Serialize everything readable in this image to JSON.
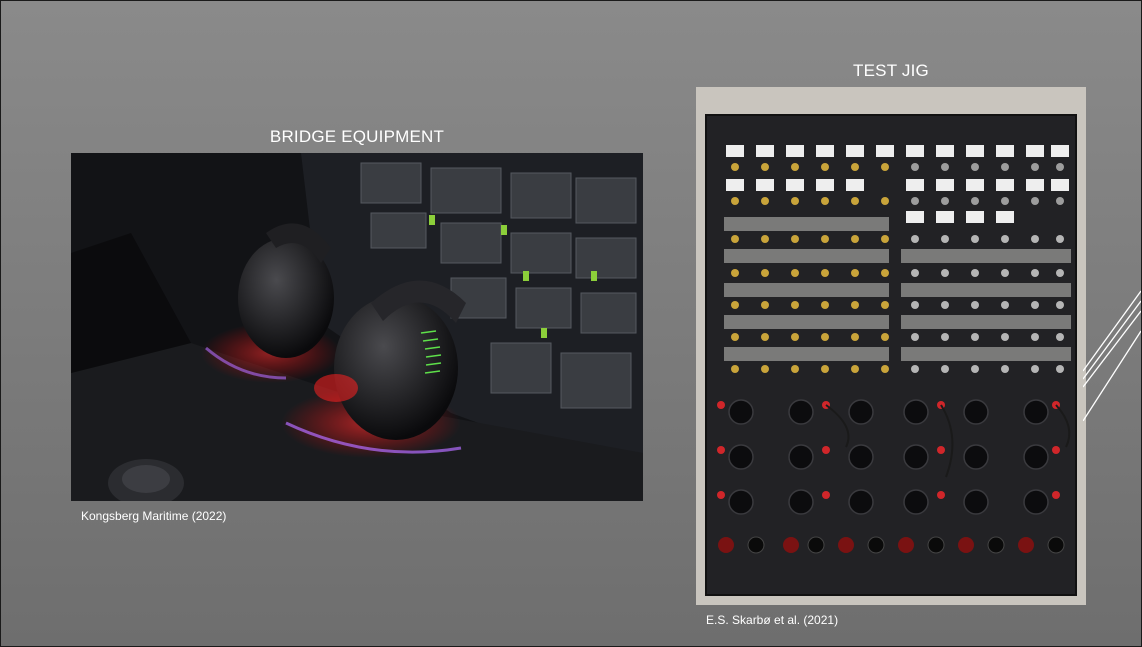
{
  "slide": {
    "left_panel": {
      "title": "BRIDGE EQUIPMENT",
      "caption": "Kongsberg Maritime (2022)"
    },
    "right_panel": {
      "title": "TEST JIG",
      "caption": "E.S. Skarbø et al. (2021)"
    }
  }
}
